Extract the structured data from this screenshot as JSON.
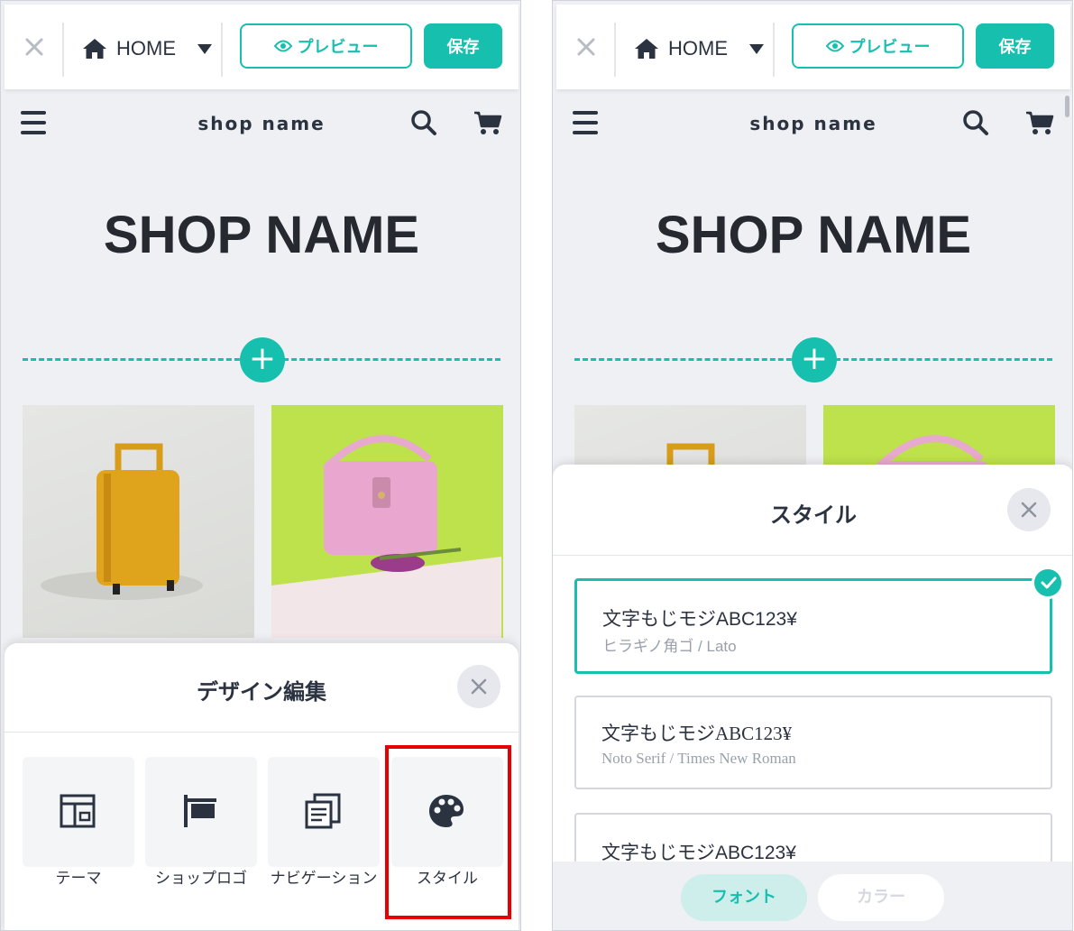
{
  "editor": {
    "home_label": "HOME",
    "preview_label": "プレビュー",
    "save_label": "保存"
  },
  "shop": {
    "header_name": "shop name",
    "hero_name": "SHOP NAME"
  },
  "design_sheet": {
    "title": "デザイン編集",
    "tiles": [
      {
        "label": "テーマ",
        "icon": "layout-icon"
      },
      {
        "label": "ショップロゴ",
        "icon": "signboard-icon"
      },
      {
        "label": "ナビゲーション",
        "icon": "newspaper-icon"
      },
      {
        "label": "スタイル",
        "icon": "palette-icon"
      }
    ]
  },
  "style_sheet": {
    "title": "スタイル",
    "options": [
      {
        "sample": "文字もじモジABC123¥",
        "fonts": "ヒラギノ角ゴ / Lato",
        "selected": true
      },
      {
        "sample": "文字もじモジABC123¥",
        "fonts": "Noto Serif / Times New Roman",
        "selected": false
      },
      {
        "sample": "文字もじモジABC123¥",
        "fonts": "",
        "selected": false
      }
    ],
    "tabs": {
      "font": "フォント",
      "color": "カラー"
    }
  },
  "colors": {
    "accent": "#17bfae",
    "highlight": "#e60000",
    "text": "#2b3240"
  }
}
